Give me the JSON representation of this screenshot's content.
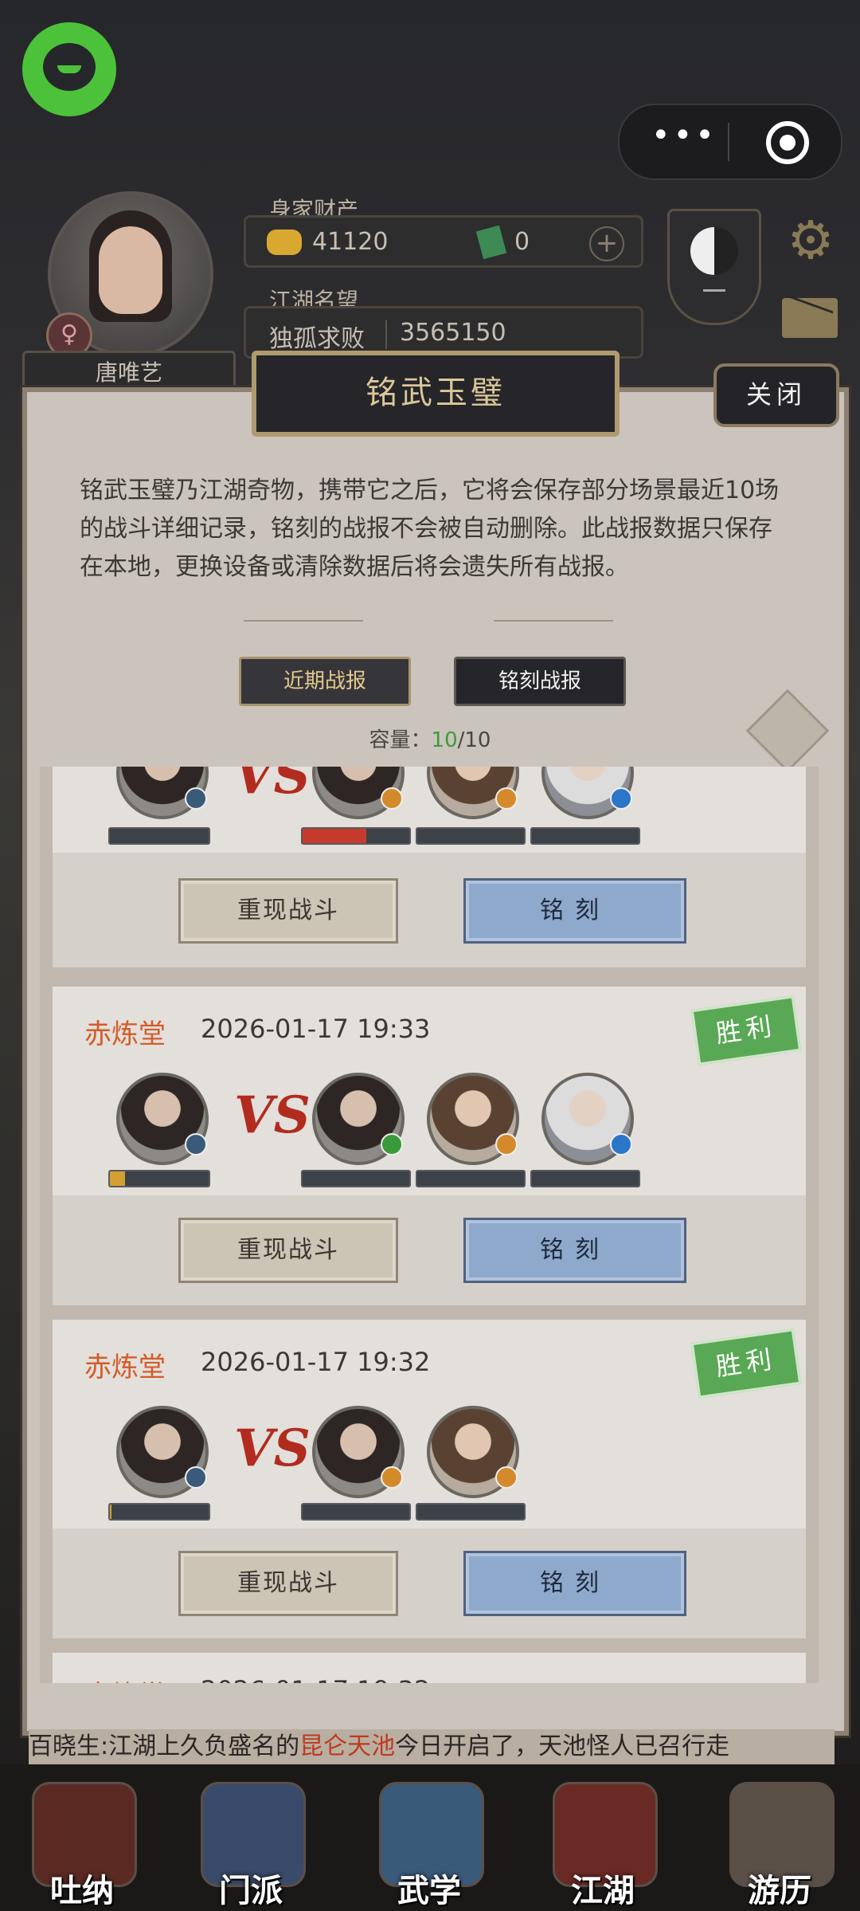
{
  "header": {
    "assets_label": "身家财产",
    "gold_amount": "41120",
    "jade_amount": "0",
    "plus_label": "+",
    "reputation_label": "江湖名望",
    "reputation_title": "独孤求败",
    "reputation_value": "3565150",
    "player_name": "唐唯艺",
    "gender_symbol": "♀",
    "taiji_value": "-",
    "settings_icon": "gear-icon",
    "mail_icon": "mail-icon"
  },
  "capsule": {
    "more_icon": "more-dots-icon",
    "close_icon": "target-icon",
    "dots": "•••"
  },
  "dialog": {
    "title": "铭武玉璧",
    "close_label": "关闭",
    "description": "铭武玉璧乃江湖奇物，携带它之后，它将会保存部分场景最近10场的战斗详细记录，铭刻的战报不会被自动删除。此战报数据只保存在本地，更换设备或清除数据后将会遗失所有战报。",
    "tabs": [
      {
        "label": "近期战报",
        "active": true
      },
      {
        "label": "铭刻战报",
        "active": false
      }
    ],
    "capacity_label": "容量：",
    "capacity_used": "10",
    "capacity_total": "/10",
    "swap_icon": "swap-icon"
  },
  "reports": [
    {
      "guild": "",
      "time": "",
      "result": "",
      "enemy_count": 3,
      "player_hp": 0,
      "enemy_hp": [
        0.6,
        0,
        0
      ],
      "replay_label": "重现战斗",
      "engrave_label": "铭刻"
    },
    {
      "guild": "赤炼堂",
      "time": "2026-01-17 19:33",
      "result": "胜利",
      "enemy_count": 3,
      "player_hp": 0.15,
      "enemy_hp": [
        0,
        0,
        0
      ],
      "replay_label": "重现战斗",
      "engrave_label": "铭刻"
    },
    {
      "guild": "赤炼堂",
      "time": "2026-01-17 19:32",
      "result": "胜利",
      "enemy_count": 2,
      "player_hp": 0.02,
      "enemy_hp": [
        0,
        0
      ],
      "replay_label": "重现战斗",
      "engrave_label": "铭刻"
    },
    {
      "guild": "赤炼堂",
      "time": "2026-01-17 19:32",
      "result": "",
      "partial": true
    }
  ],
  "vs_text": "VS",
  "marquee": {
    "prefix": "百晓生:江湖上久负盛名的",
    "highlight": "昆仑天池",
    "suffix": "今日开启了，天池怪人已召行走"
  },
  "bottom_nav": [
    {
      "label": "吐纳",
      "icon": "meditation-icon"
    },
    {
      "label": "门派",
      "icon": "sect-icon"
    },
    {
      "label": "武学",
      "icon": "martial-arts-icon"
    },
    {
      "label": "江湖",
      "icon": "world-icon"
    },
    {
      "label": "游历",
      "icon": "travel-icon"
    }
  ],
  "colors": {
    "win_green": "#59a855",
    "guild_orange": "#d35c2a",
    "hp_red": "#c63a2c",
    "hp_gold": "#d4a034",
    "accent_gold": "#b09a6f"
  }
}
